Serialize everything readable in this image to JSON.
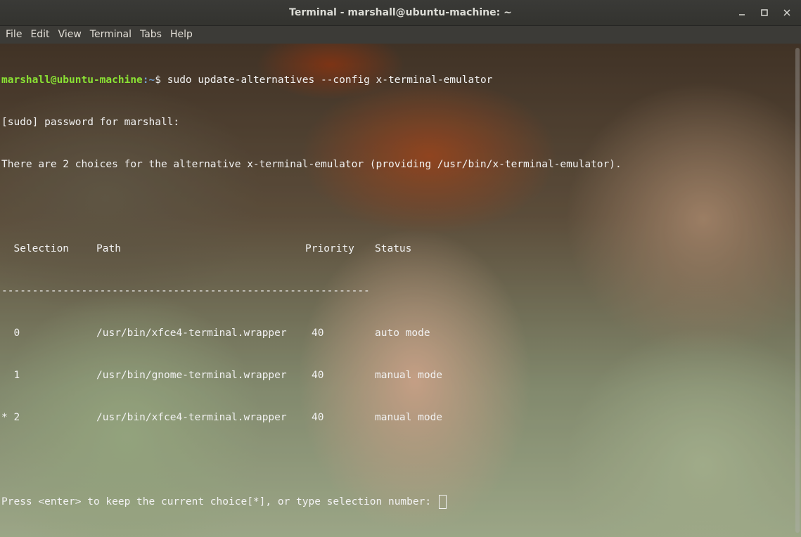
{
  "window": {
    "title": "Terminal - marshall@ubuntu-machine: ~",
    "minimize_glyph": "minimize-icon",
    "maximize_glyph": "maximize-icon",
    "close_glyph": "close-icon"
  },
  "menu": {
    "items": [
      "File",
      "Edit",
      "View",
      "Terminal",
      "Tabs",
      "Help"
    ]
  },
  "terminal": {
    "prompt_user": "marshall@ubuntu-machine",
    "prompt_path": ":~",
    "prompt_symbol": "$",
    "command": " sudo update-alternatives --config x-terminal-emulator",
    "line_sudo": "[sudo] password for marshall:",
    "line_choices": "There are 2 choices for the alternative x-terminal-emulator (providing /usr/bin/x-terminal-emulator).",
    "table": {
      "headers": [
        "  Selection",
        "Path",
        "Priority",
        "Status"
      ],
      "separator": "------------------------------------------------------------",
      "rows": [
        {
          "selection": "  0",
          "path": "/usr/bin/xfce4-terminal.wrapper",
          "priority": "40",
          "status": "auto mode"
        },
        {
          "selection": "  1",
          "path": "/usr/bin/gnome-terminal.wrapper",
          "priority": "40",
          "status": "manual mode"
        },
        {
          "selection": "* 2",
          "path": "/usr/bin/xfce4-terminal.wrapper",
          "priority": "40",
          "status": "manual mode"
        }
      ]
    },
    "line_press": "Press <enter> to keep the current choice[*], or type selection number: "
  },
  "colors": {
    "prompt_user": "#8ae234",
    "prompt_path": "#729fcf",
    "text": "#f2f2f2",
    "titlebar": "#3a3a37"
  }
}
